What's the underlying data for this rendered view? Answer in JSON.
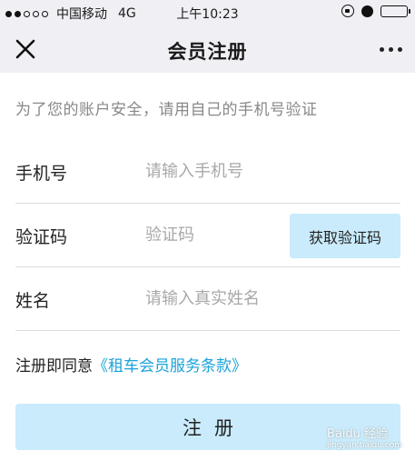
{
  "status_bar": {
    "carrier": "中国移动",
    "network": "4G",
    "time": "上午10:23",
    "battery_level": 0.9
  },
  "nav": {
    "title": "会员注册",
    "close_icon": "close-icon",
    "more_icon": "more-icon"
  },
  "form": {
    "hint": "为了您的账户安全，请用自己的手机号验证",
    "phone": {
      "label": "手机号",
      "placeholder": "请输入手机号",
      "value": ""
    },
    "code": {
      "label": "验证码",
      "placeholder": "验证码",
      "value": "",
      "button_label": "获取验证码"
    },
    "name": {
      "label": "姓名",
      "placeholder": "请输入真实姓名",
      "value": ""
    },
    "agree_prefix": "注册即同意",
    "agree_link": "《租车会员服务条款》",
    "submit_label": "注册"
  },
  "watermark": {
    "brand": "Baidu 经验",
    "url": "jingyan.baidu.com"
  },
  "colors": {
    "background": "#ffffff",
    "bar_background": "#efeff4",
    "button_background": "#c9ebfb",
    "link": "#1aa3d9",
    "placeholder": "#a8a8a8",
    "hint": "#888888"
  }
}
